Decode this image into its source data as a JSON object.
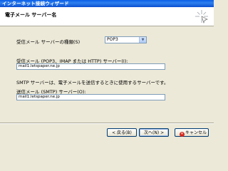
{
  "window": {
    "title": "インターネット接続ウィザード"
  },
  "header": {
    "title": "電子メール サーバー名"
  },
  "form": {
    "server_type_label": "受信メール サーバーの種類(S)",
    "server_type_value": "POP3",
    "incoming_label": "受信メール (POP3、IMAP または HTTP) サーバー(I):",
    "incoming_value": "mail1.letspaper.ne.jp",
    "smtp_note": "SMTP サーバーは、電子メールを送信するときに使用するサーバーです。",
    "outgoing_label": "送信メール (SMTP) サーバー(O):",
    "outgoing_value": "mail1.letspaper.ne.jp"
  },
  "buttons": {
    "back": "< 戻る(B)",
    "next": "次へ(N) >",
    "cancel": "キャンセル"
  },
  "icons": {
    "wizard": "wizard-sparkle-icon",
    "dropdown": "chevron-down-icon",
    "cancel": "cancel-x-icon"
  }
}
